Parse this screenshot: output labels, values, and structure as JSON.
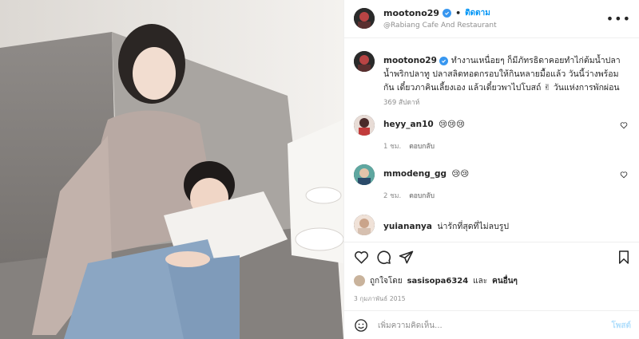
{
  "header": {
    "username": "mootono29",
    "dot": "•",
    "follow_label": "ติดตาม",
    "location": "@Rabiang Cafe And Restaurant",
    "more_label": "•••"
  },
  "caption": {
    "username": "mootono29",
    "text": "ทำงานเหนื่อยๆ ก็มีภัทรธิดาคอยทำไก่ต้มน้ำปลา น้ำพริกปลาทู ปลาสลิดทอดกรอบให้กินหลายมื้อแล้ว วันนี้ว่างพร้อมกัน เดี๋ยวภาคินเลี้ยงเอง แล้วเดี๋ยวพาไปโบสถ์ ✌ วันแห่งการพักผ่อน",
    "time": "369 สัปดาห์"
  },
  "comments": [
    {
      "username": "heyy_an10",
      "text": "😢😢😢",
      "time": "1 ชม.",
      "reply": "ตอบกลับ"
    },
    {
      "username": "mmodeng_gg",
      "text": "😢😢",
      "time": "2 ชม.",
      "reply": "ตอบกลับ"
    },
    {
      "username": "yuiananya",
      "text": "น่ารักที่สุดที่ไม่ลบรูป",
      "time": "",
      "reply": ""
    }
  ],
  "likes": {
    "prefix": "ถูกใจโดย",
    "user": "sasisopa6324",
    "conj": "และ",
    "others": "คนอื่นๆ"
  },
  "post_date": "3 กุมภาพันธ์ 2015",
  "add_comment": {
    "placeholder": "เพิ่มความคิดเห็น...",
    "post_label": "โพสต์"
  },
  "icons": {
    "verified": "verified-badge-icon",
    "heart": "heart-icon",
    "comment": "comment-icon",
    "share": "share-icon",
    "save": "bookmark-icon",
    "emoji": "emoji-icon"
  },
  "colors": {
    "accent": "#0095f6",
    "verified": "#3897f0",
    "muted": "#8e8e8e"
  }
}
